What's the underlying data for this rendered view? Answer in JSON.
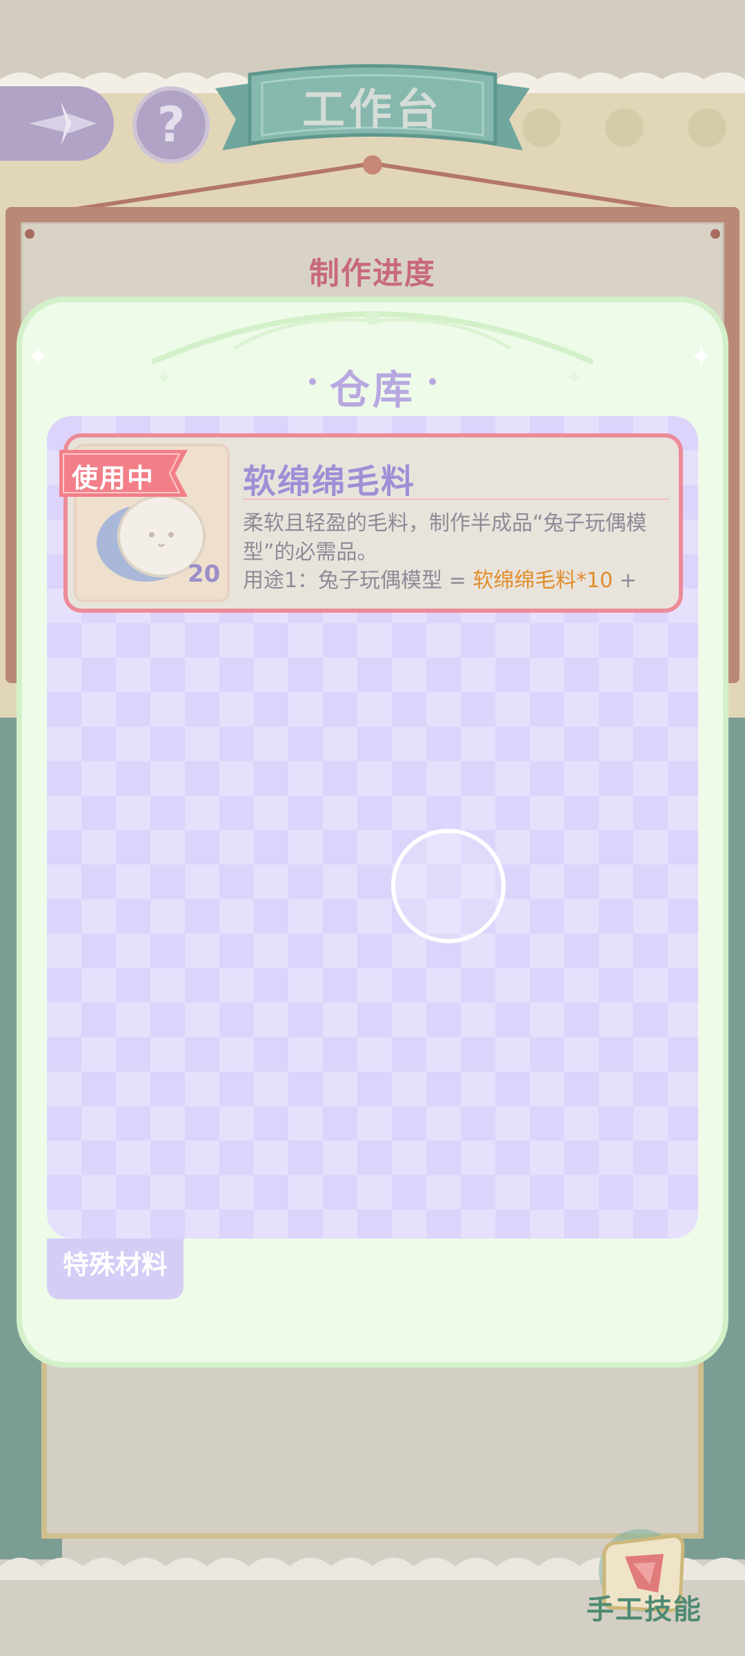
{
  "header": {
    "title": "工作台",
    "help_label": "?"
  },
  "background": {
    "progress_title": "制作进度"
  },
  "warehouse": {
    "title": "仓库",
    "items": [
      {
        "tag": "使用中",
        "name": "软绵绵毛料",
        "count": "20",
        "description": "柔软且轻盈的毛料，制作半成品“兔子玩偶模型”的必需品。",
        "use_prefix": "用途1：兔子玩偶模型 = ",
        "use_highlight": "软绵绵毛料*10",
        "use_suffix": " +"
      }
    ],
    "tabs": [
      {
        "label": "特殊材料",
        "selected": true
      }
    ]
  },
  "skill": {
    "label": "手工技能"
  },
  "colors": {
    "accent_purple": "#b8a8e0",
    "card_border": "#ec8b98",
    "highlight_orange": "#e18c2a",
    "skill_green": "#4f8a74"
  }
}
